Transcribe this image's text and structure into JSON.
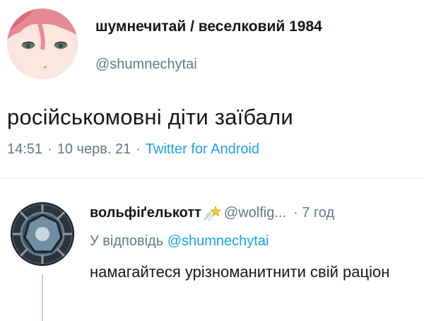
{
  "main_tweet": {
    "display_name": "шумнечитай / веселковий 1984",
    "handle": "@shumnechytai",
    "text": "російськомовні діти заїбали",
    "time": "14:51",
    "separator": "·",
    "date": "10 черв. 21",
    "source": "Twitter for Android"
  },
  "reply": {
    "display_name": "вольфіґелькотт",
    "handle": "@wolfig...",
    "separator": "·",
    "time": "7 год",
    "replying_to_prefix": "У відповідь",
    "replying_to_mention": "@shumnechytai",
    "text": "намагайтеся урізноманитнити свій раціон"
  },
  "colors": {
    "text_primary": "#14171a",
    "text_secondary": "#657786",
    "link": "#1da1f2",
    "divider": "#e1e8ed"
  },
  "icons": {
    "main_avatar": "anime-character-avatar",
    "reply_avatar": "spaceship-window-avatar",
    "name_badge": "shooting-star-emoji"
  }
}
